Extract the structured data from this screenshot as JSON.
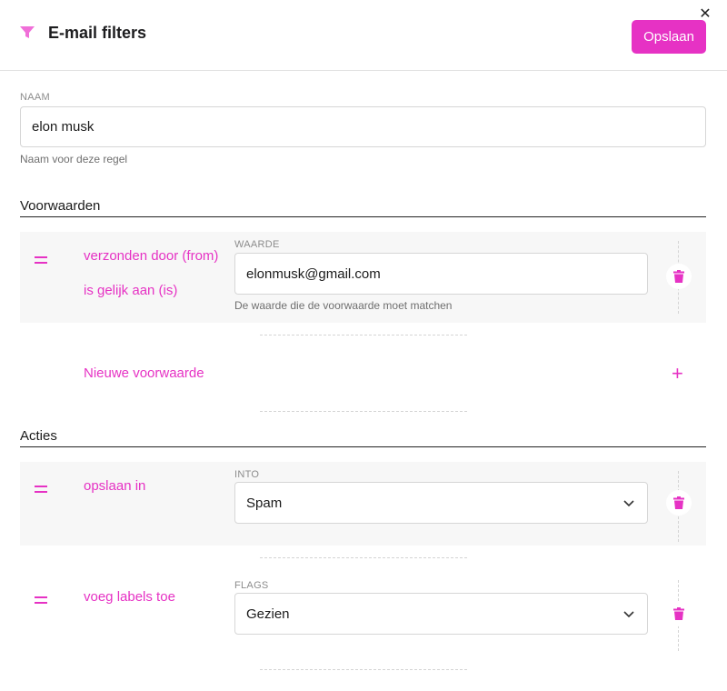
{
  "header": {
    "title": "E-mail filters",
    "save_label": "Opslaan",
    "close_glyph": "✕",
    "icon": "funnel-icon"
  },
  "name_field": {
    "label": "NAAM",
    "value": "elon musk",
    "helper": "Naam voor deze regel"
  },
  "conditions": {
    "title": "Voorwaarden",
    "items": [
      {
        "field": "verzonden door (from)",
        "operator": "is gelijk aan (is)",
        "value_label": "WAARDE",
        "value": "elonmusk@gmail.com",
        "value_helper": "De waarde die de voorwaarde moet matchen"
      }
    ],
    "add_label": "Nieuwe voorwaarde",
    "add_icon": "plus-icon"
  },
  "actions": {
    "title": "Acties",
    "items": [
      {
        "action": "opslaan in",
        "param_label": "INTO",
        "selected": "Spam"
      },
      {
        "action": "voeg labels toe",
        "param_label": "FLAGS",
        "selected": "Gezien"
      }
    ]
  },
  "colors": {
    "accent": "#e632c4",
    "block_bg": "#f7f7f7",
    "border": "#d6d6d6"
  }
}
